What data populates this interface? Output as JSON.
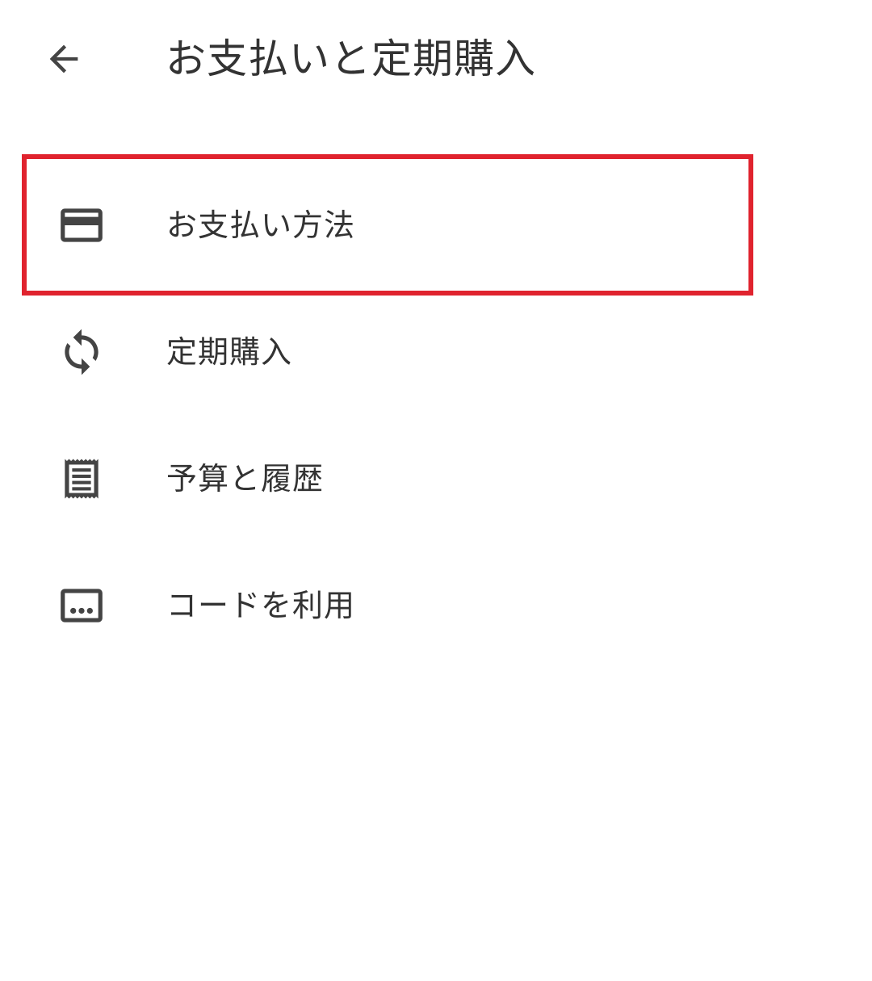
{
  "header": {
    "title": "お支払いと定期購入",
    "back_icon": "arrow-left-icon"
  },
  "menu": {
    "items": [
      {
        "label": "お支払い方法",
        "icon": "credit-card-icon"
      },
      {
        "label": "定期購入",
        "icon": "sync-icon"
      },
      {
        "label": "予算と履歴",
        "icon": "receipt-icon"
      },
      {
        "label": "コードを利用",
        "icon": "redeem-code-icon"
      }
    ]
  },
  "colors": {
    "text": "#333333",
    "icon": "#444444",
    "highlight": "#e0232e",
    "background": "#ffffff"
  }
}
